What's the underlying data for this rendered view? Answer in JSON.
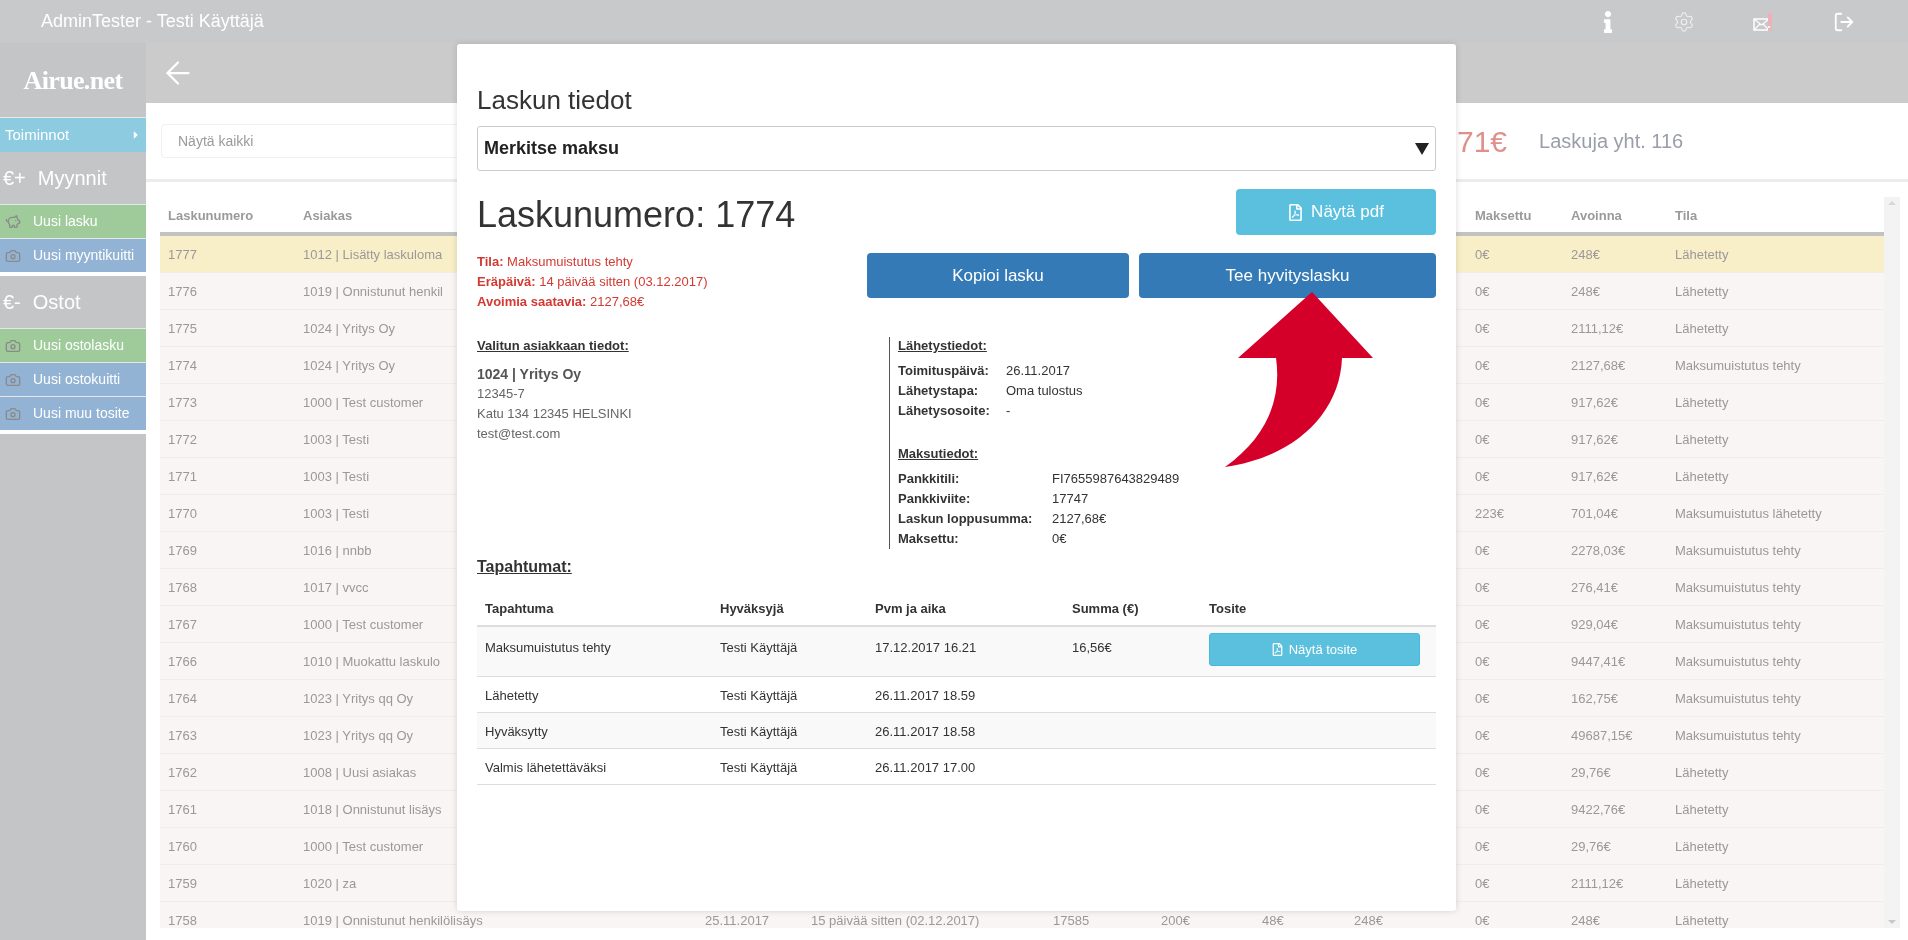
{
  "topbar": {
    "title": "AdminTester - Testi Käyttäjä"
  },
  "sidebar": {
    "logo": "Airue.net",
    "actions_label": "Toiminnot",
    "sections": [
      {
        "symbol": "€+",
        "title": "Myynnit",
        "items": [
          {
            "label": "Uusi lasku",
            "color": "#9fcb9b"
          },
          {
            "label": "Uusi myyntikuitti",
            "color": "#92b3d3"
          }
        ]
      },
      {
        "symbol": "€-",
        "title": "Ostot",
        "items": [
          {
            "label": "Uusi ostolasku",
            "color": "#9fcb9b"
          },
          {
            "label": "Uusi ostokuitti",
            "color": "#92b3d3"
          },
          {
            "label": "Uusi muu tosite",
            "color": "#92b3d3"
          }
        ]
      }
    ]
  },
  "filter": {
    "placeholder": "Näytä kaikki"
  },
  "summary": {
    "amount": "71€",
    "count": "Laskuja yht. 116"
  },
  "table": {
    "columns": [
      "Laskunumero",
      "Asiakas",
      "Maksettu",
      "Avoinna",
      "Tila"
    ],
    "rows": [
      {
        "number": "1777",
        "customer": "1012 | Lisätty laskuloma",
        "paid": "0€",
        "open": "248€",
        "status": "Lähetetty",
        "selected": true
      },
      {
        "number": "1776",
        "customer": "1019 | Onnistunut henkil",
        "paid": "0€",
        "open": "248€",
        "status": "Lähetetty",
        "selected": false
      },
      {
        "number": "1775",
        "customer": "1024 | Yritys Oy",
        "paid": "0€",
        "open": "2111,12€",
        "status": "Lähetetty",
        "selected": false
      },
      {
        "number": "1774",
        "customer": "1024 | Yritys Oy",
        "paid": "0€",
        "open": "2127,68€",
        "status": "Maksumuistutus tehty",
        "selected": false
      },
      {
        "number": "1773",
        "customer": "1000 | Test customer",
        "paid": "0€",
        "open": "917,62€",
        "status": "Lähetetty",
        "selected": false
      },
      {
        "number": "1772",
        "customer": "1003 | Testi",
        "paid": "0€",
        "open": "917,62€",
        "status": "Lähetetty",
        "selected": false
      },
      {
        "number": "1771",
        "customer": "1003 | Testi",
        "paid": "0€",
        "open": "917,62€",
        "status": "Lähetetty",
        "selected": false
      },
      {
        "number": "1770",
        "customer": "1003 | Testi",
        "paid": "223€",
        "open": "701,04€",
        "status": "Maksumuistutus lähetetty",
        "selected": false
      },
      {
        "number": "1769",
        "customer": "1016 | nnbb",
        "paid": "0€",
        "open": "2278,03€",
        "status": "Maksumuistutus tehty",
        "selected": false
      },
      {
        "number": "1768",
        "customer": "1017 | vvcc",
        "paid": "0€",
        "open": "276,41€",
        "status": "Maksumuistutus tehty",
        "selected": false
      },
      {
        "number": "1767",
        "customer": "1000 | Test customer",
        "paid": "0€",
        "open": "929,04€",
        "status": "Maksumuistutus tehty",
        "selected": false
      },
      {
        "number": "1766",
        "customer": "1010 | Muokattu laskulo",
        "paid": "0€",
        "open": "9447,41€",
        "status": "Maksumuistutus tehty",
        "selected": false
      },
      {
        "number": "1764",
        "customer": "1023 | Yritys qq Oy",
        "paid": "0€",
        "open": "162,75€",
        "status": "Maksumuistutus tehty",
        "selected": false
      },
      {
        "number": "1763",
        "customer": "1023 | Yritys qq Oy",
        "paid": "0€",
        "open": "49687,15€",
        "status": "Maksumuistutus tehty",
        "selected": false
      },
      {
        "number": "1762",
        "customer": "1008 | Uusi asiakas",
        "paid": "0€",
        "open": "29,76€",
        "status": "Lähetetty",
        "selected": false
      },
      {
        "number": "1761",
        "customer": "1018 | Onnistunut lisäys",
        "paid": "0€",
        "open": "9422,76€",
        "status": "Lähetetty",
        "selected": false
      },
      {
        "number": "1760",
        "customer": "1000 | Test customer",
        "paid": "0€",
        "open": "29,76€",
        "status": "Lähetetty",
        "selected": false
      },
      {
        "number": "1759",
        "customer": "1020 | za",
        "paid": "0€",
        "open": "2111,12€",
        "status": "Lähetetty",
        "selected": false
      },
      {
        "number": "1758",
        "customer": "1019 | Onnistunut henkilölisäys",
        "extra": [
          "25.11.2017",
          "15 päivää sitten (02.12.2017)",
          "17585",
          "200€",
          "48€",
          "248€"
        ],
        "paid": "0€",
        "open": "248€",
        "status": "Lähetetty",
        "selected": false
      }
    ]
  },
  "modal": {
    "title": "Laskun tiedot",
    "action_select": {
      "value": "Merkitse maksu"
    },
    "invoice_heading": "Laskunumero: 1774",
    "pdf_button": "Näytä pdf",
    "status_lines": [
      "**Tila:** Maksumuistutus tehty",
      "**Eräpäivä:** 14 päivää sitten (03.12.2017)",
      "**Avoimia saatavia:** 2127,68€"
    ],
    "buttons": [
      "Kopioi lasku",
      "Tee hyvityslasku"
    ],
    "customer": {
      "heading": "Valitun asiakkaan tiedot:",
      "name": "1024 | Yritys Oy",
      "lines": [
        "12345-7",
        "Katu 134 12345 HELSINKI",
        "test@test.com"
      ]
    },
    "delivery": {
      "heading": "Lähetystiedot:",
      "fields": [
        {
          "label": "Toimituspäivä:",
          "value": "26.11.2017"
        },
        {
          "label": "Lähetystapa:",
          "value": "Oma tulostus"
        },
        {
          "label": "Lähetysosoite:",
          "value": "-"
        }
      ]
    },
    "payment": {
      "heading": "Maksutiedot:",
      "fields": [
        {
          "label": "Pankkitili:",
          "value": "FI7655987643829489"
        },
        {
          "label": "Pankkiviite:",
          "value": "17747"
        },
        {
          "label": "Laskun loppusumma:",
          "value": "2127,68€"
        },
        {
          "label": "Maksettu:",
          "value": "0€"
        }
      ]
    },
    "events": {
      "heading": "Tapahtumat:",
      "columns": [
        "Tapahtuma",
        "Hyväksyjä",
        "Pvm ja aika",
        "Summa (€)",
        "Tosite"
      ],
      "rows": [
        {
          "event": "Maksumuistutus tehty",
          "approver": "Testi Käyttäjä",
          "time": "17.12.2017 16.21",
          "amount": "16,56€",
          "receipt_button": "Näytä tosite"
        },
        {
          "event": "Lähetetty",
          "approver": "Testi Käyttäjä",
          "time": "26.11.2017 18.59"
        },
        {
          "event": "Hyväksytty",
          "approver": "Testi Käyttäjä",
          "time": "26.11.2017 18.58"
        },
        {
          "event": "Valmis lähetettäväksi",
          "approver": "Testi Käyttäjä",
          "time": "26.11.2017 17.00"
        }
      ]
    }
  }
}
